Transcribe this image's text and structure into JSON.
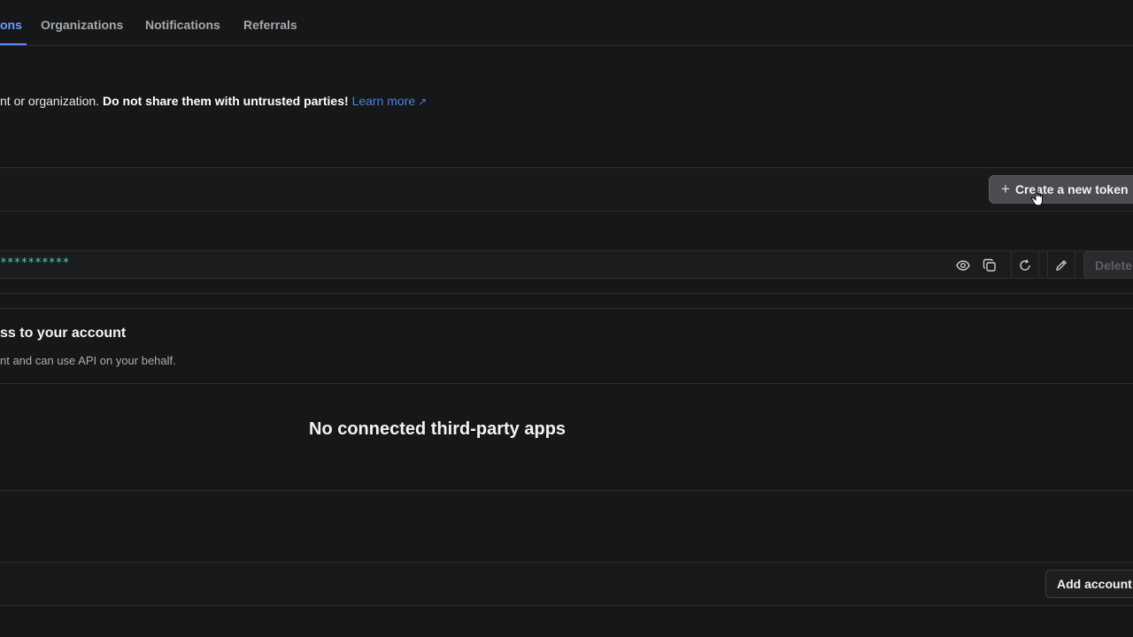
{
  "tabs": [
    {
      "label": "ons",
      "active": true
    },
    {
      "label": "Organizations",
      "active": false
    },
    {
      "label": "Notifications",
      "active": false
    },
    {
      "label": "Referrals",
      "active": false
    }
  ],
  "warning": {
    "prefix": "nt or organization. ",
    "bold": "Do not share them with untrusted parties!",
    "link": "Learn more",
    "link_icon": "external-link-icon"
  },
  "tokens": {
    "create_label": "Create a new token",
    "value": "**********",
    "delete_label": "Delete",
    "icons": [
      "eye-icon",
      "copy-icon",
      "regenerate-icon",
      "edit-icon"
    ]
  },
  "apps": {
    "title": "ss to your account",
    "subtitle": "nt and can use API on your behalf.",
    "empty_text": "No connected third-party apps"
  },
  "accounts": {
    "add_label": "Add account"
  },
  "colors": {
    "background": "#161718",
    "accent": "#6f9bff",
    "token_text": "#4fd1b6"
  }
}
